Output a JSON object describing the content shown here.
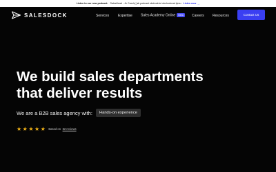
{
  "announcement": {
    "lead": "Listen to our new podcast:",
    "text": "SalesHead - Je Czech(.)sk podcast obchodníci obchodovat týmu",
    "link": "Listen now",
    "link_icon": "arrow-right-icon"
  },
  "brand": {
    "name": "SALESDOCK",
    "logo_icon": "paper-plane-icon"
  },
  "nav": {
    "items": [
      {
        "label": "Services"
      },
      {
        "label": "Expertise"
      },
      {
        "label": "Sales Academy Online",
        "badge": "Beta"
      },
      {
        "label": "Careers"
      },
      {
        "label": "Resources"
      }
    ],
    "cta": "Contact Us"
  },
  "hero": {
    "title_line1": "We build sales departments",
    "title_line2": "that deliver results",
    "subtitle": "We are a B2B sales agency with:",
    "highlight": "Hands-on experience"
  },
  "rating": {
    "stars": 5,
    "based_on": "Based on",
    "reviews": "62 reviews"
  },
  "colors": {
    "background": "#050505",
    "accent": "#3a3ff2",
    "star": "#f4b518"
  }
}
